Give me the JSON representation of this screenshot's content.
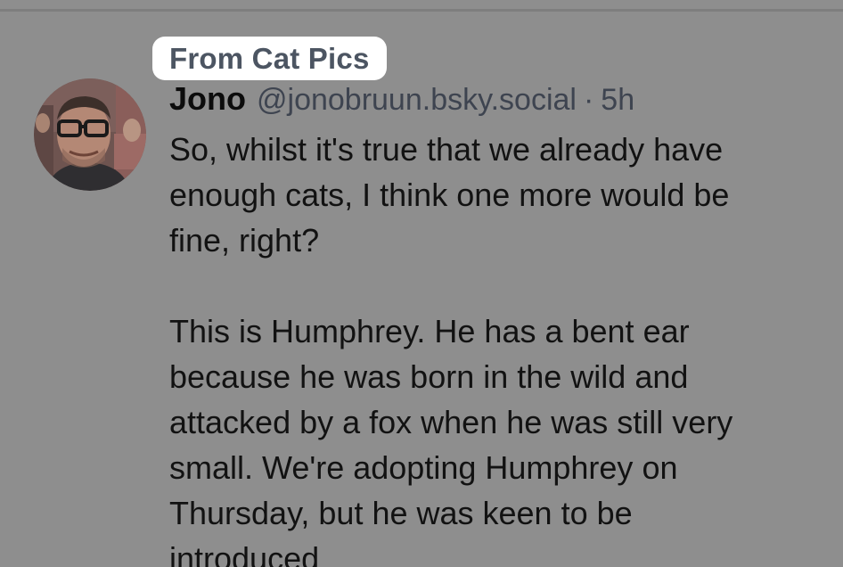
{
  "feed": {
    "source_label": "From Cat Pics"
  },
  "post": {
    "author": {
      "display_name": "Jono",
      "handle": "@jonobruun.bsky.social",
      "avatar_icon": "user-avatar-photo"
    },
    "separator": "·",
    "time_ago": "5h",
    "paragraphs": [
      "So, whilst it's true that we already have\nenough cats, I think one more would be\nfine, right?",
      "This is Humphrey. He has a bent ear\nbecause he was born in the wild and\nattacked by a fox when he was still very\nsmall. We're adopting Humphrey on\nThursday, but he was keen to be\nintroduced"
    ]
  }
}
